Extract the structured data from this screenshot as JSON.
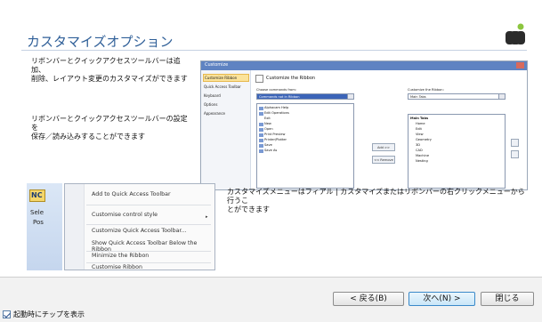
{
  "header": {
    "title": "カスタマイズオプション"
  },
  "descriptions": {
    "ribbon_edit": "リボンバーとクイックアクセスツールバーは追加、\n削除、レイアウト変更のカスタマイズができます",
    "save_load": "リボンバーとクイックアクセスツールバーの設定を\n保存／読み込みすることができます",
    "menu_hint": "カスタマイズメニューはフィアル | カスタマイズまたはリボンバーの右クリックメニューから行うこ\nとができます"
  },
  "customize_dialog": {
    "title": "Customize",
    "nav": [
      "Customize Ribbon",
      "Quick Access Toolbar",
      "Keyboard",
      "Options",
      "Appearance"
    ],
    "heading": "Customize the Ribbon",
    "choose_label": "Choose commands from:",
    "choose_value": "Commands not in Ribbon",
    "customize_label": "Customize the Ribbon:",
    "customize_value": "Main Tabs",
    "commands": [
      "Alphacam Help",
      "Edit Operations",
      "Exit",
      "New",
      "Open",
      "Print Preview",
      "Printer/Plotter",
      "Save",
      "Save As"
    ],
    "add_button": "Add >>",
    "remove_button": "<< Remove",
    "tree_header": "Main Tabs",
    "tabs": [
      "Home",
      "Edit",
      "View",
      "Geometry",
      "3D",
      "CAD",
      "Machine",
      "Nesting"
    ]
  },
  "ribbon_preview": {
    "labels": [
      "Sele",
      "Pos"
    ],
    "qat_badge": "NC"
  },
  "context_menu": {
    "items": [
      "Add to Quick Access Toolbar",
      "Customise control style",
      "Customize Quick Access Toolbar...",
      "Show Quick Access Toolbar Below the Ribbon",
      "Minimize the Ribbon",
      "Customise Ribbon"
    ]
  },
  "footer": {
    "back_label": "< 戻る(B)",
    "next_label": "次へ(N) >",
    "close_label": "閉じる",
    "show_tips_label": "起動時にチップを表示",
    "show_tips_checked": true
  },
  "colors": {
    "title": "#2f5f98",
    "logo": "#8cc63f"
  }
}
